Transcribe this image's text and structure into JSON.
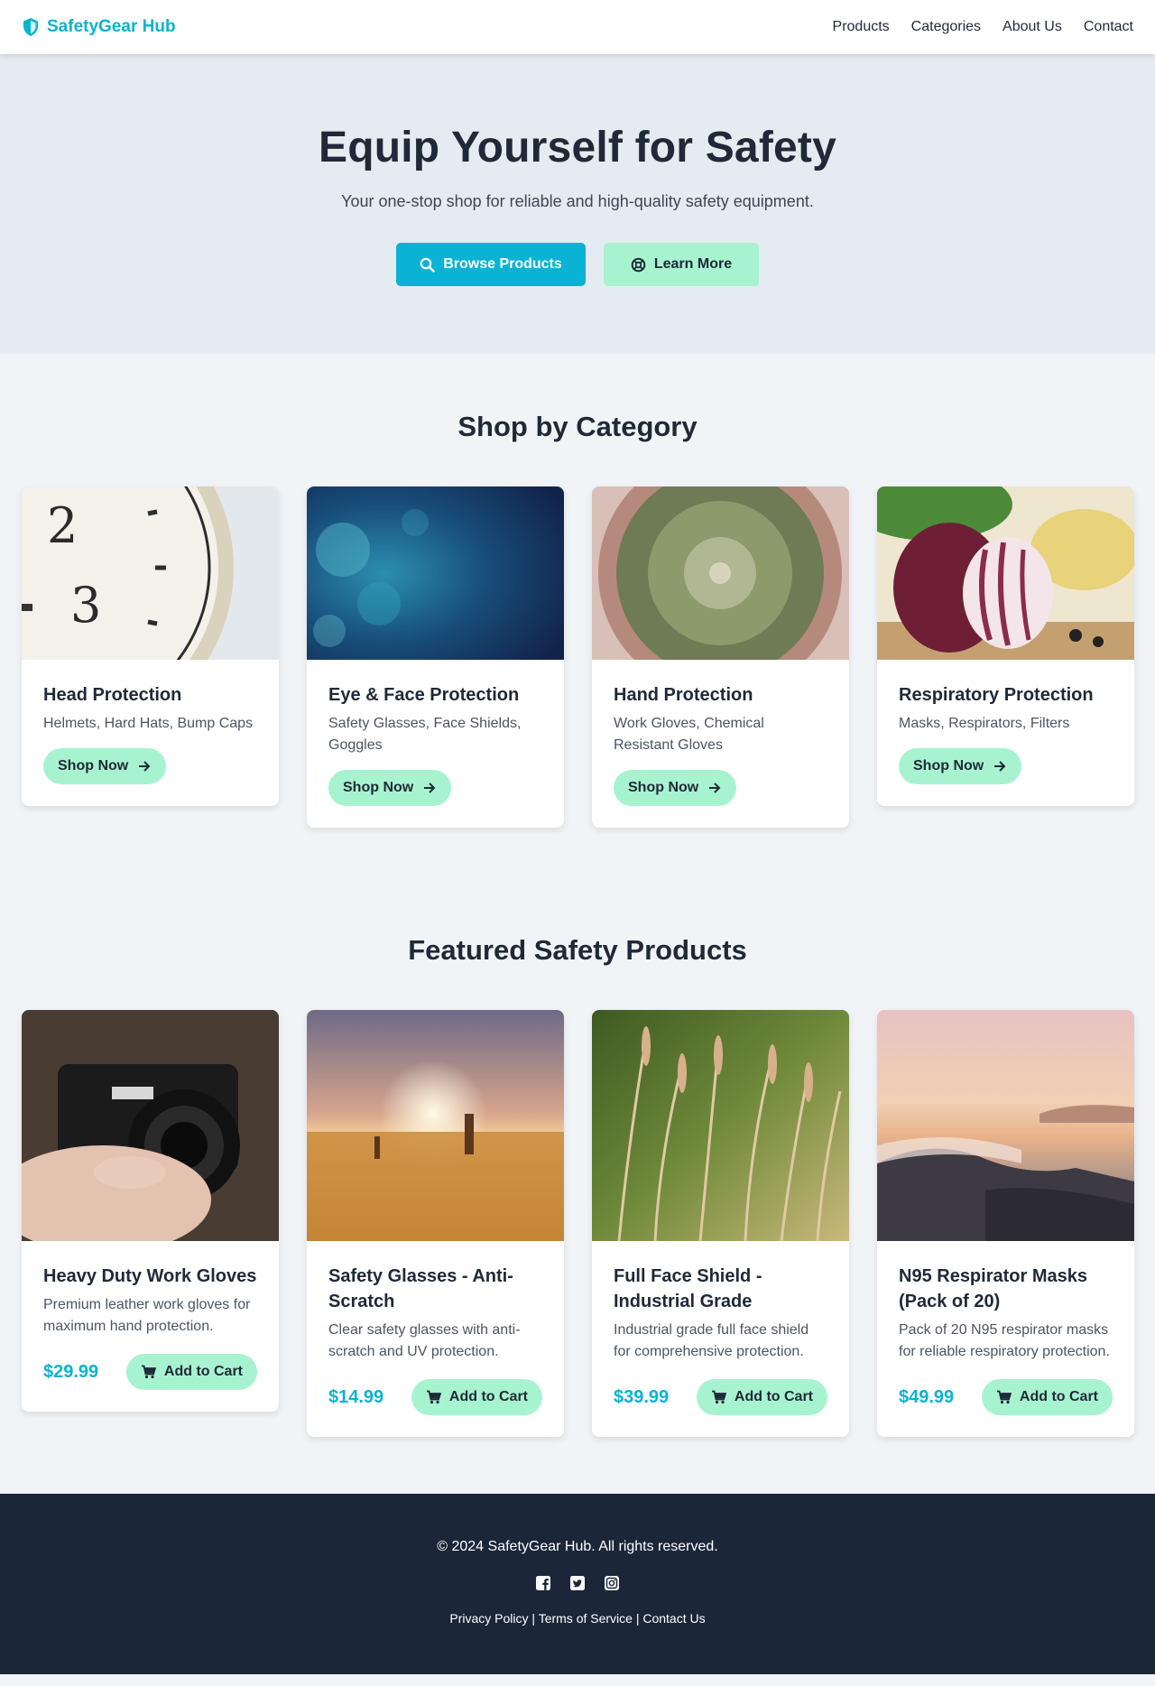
{
  "nav": {
    "brand": "SafetyGear Hub",
    "links": [
      "Products",
      "Categories",
      "About Us",
      "Contact"
    ]
  },
  "hero": {
    "title": "Equip Yourself for Safety",
    "subtitle": "Your one-stop shop for reliable and high-quality safety equipment.",
    "primary_button": "Browse Products",
    "secondary_button": "Learn More"
  },
  "categories": {
    "title": "Shop by Category",
    "button_label": "Shop Now",
    "items": [
      {
        "name": "Head Protection",
        "desc": "Helmets, Hard Hats, Bump Caps"
      },
      {
        "name": "Eye & Face Protection",
        "desc": "Safety Glasses, Face Shields, Goggles"
      },
      {
        "name": "Hand Protection",
        "desc": "Work Gloves, Chemical Resistant Gloves"
      },
      {
        "name": "Respiratory Protection",
        "desc": "Masks, Respirators, Filters"
      }
    ]
  },
  "products": {
    "title": "Featured Safety Products",
    "button_label": "Add to Cart",
    "items": [
      {
        "name": "Heavy Duty Work Gloves",
        "desc": "Premium leather work gloves for maximum hand protection.",
        "price": "$29.99"
      },
      {
        "name": "Safety Glasses - Anti-Scratch",
        "desc": "Clear safety glasses with anti-scratch and UV protection.",
        "price": "$14.99"
      },
      {
        "name": "Full Face Shield - Industrial Grade",
        "desc": "Industrial grade full face shield for comprehensive protection.",
        "price": "$39.99"
      },
      {
        "name": "N95 Respirator Masks (Pack of 20)",
        "desc": "Pack of 20 N95 respirator masks for reliable respiratory protection.",
        "price": "$49.99"
      }
    ]
  },
  "footer": {
    "copyright": "© 2024 SafetyGear Hub. All rights reserved.",
    "separator": " | ",
    "links": [
      "Privacy Policy",
      "Terms of Service",
      "Contact Us"
    ]
  },
  "colors": {
    "accent": "#0ab3d4",
    "secondary": "#a7f3d0",
    "hero_bg": "#e4ecf1",
    "page_bg": "#f1f4f7",
    "footer_bg": "#1c2639",
    "text": "#1f2937"
  },
  "icons": {
    "brand": "shield-icon",
    "browse": "search-icon",
    "learn": "lifebuoy-icon",
    "shop": "arrow-right-icon",
    "cart": "cart-icon",
    "socials": [
      "facebook-icon",
      "twitter-icon",
      "instagram-icon"
    ]
  }
}
